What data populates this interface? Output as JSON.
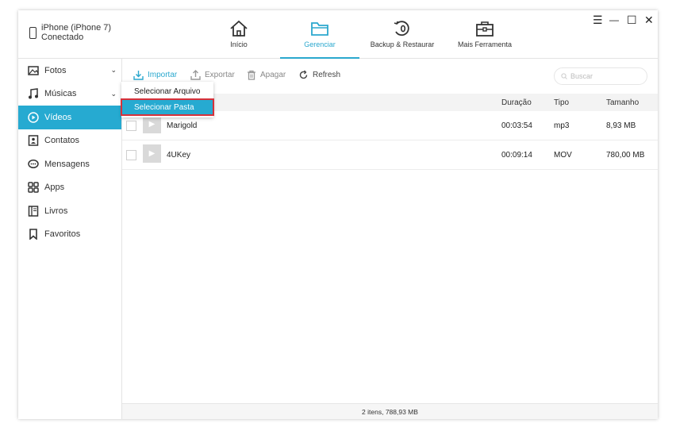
{
  "device": {
    "name": "iPhone (iPhone 7)",
    "status": "Conectado"
  },
  "nav": {
    "tabs": [
      {
        "label": "Início",
        "icon": "home-icon"
      },
      {
        "label": "Gerenciar",
        "icon": "folder-icon"
      },
      {
        "label": "Backup & Restaurar",
        "icon": "backup-restore-icon"
      },
      {
        "label": "Mais Ferramenta",
        "icon": "toolbox-icon"
      }
    ],
    "active": "Gerenciar"
  },
  "window_controls": {
    "menu": "☰",
    "minimize": "—",
    "maximize": "☐",
    "close": "✕"
  },
  "sidebar": {
    "items": [
      {
        "label": "Fotos",
        "icon": "photo-icon"
      },
      {
        "label": "Músicas",
        "icon": "music-icon"
      },
      {
        "label": "Vídeos",
        "icon": "video-icon"
      },
      {
        "label": "Contatos",
        "icon": "contact-icon"
      },
      {
        "label": "Mensagens",
        "icon": "message-icon"
      },
      {
        "label": "Apps",
        "icon": "apps-icon"
      },
      {
        "label": "Livros",
        "icon": "book-icon"
      },
      {
        "label": "Favoritos",
        "icon": "bookmark-icon"
      }
    ],
    "active": "Vídeos"
  },
  "toolbar": {
    "import": "Importar",
    "export": "Exportar",
    "delete": "Apagar",
    "refresh": "Refresh",
    "search_placeholder": "Buscar"
  },
  "dropdown": {
    "items": [
      "Selecionar Arquivo",
      "Selecionar Pasta"
    ],
    "highlighted": "Selecionar Pasta"
  },
  "table": {
    "columns": [
      "Duração",
      "Tipo",
      "Tamanho"
    ],
    "rows": [
      {
        "name": "Marigold",
        "duration": "00:03:54",
        "type": "mp3",
        "size": "8,93 MB"
      },
      {
        "name": "4UKey",
        "duration": "00:09:14",
        "type": "MOV",
        "size": "780,00 MB"
      }
    ]
  },
  "status": "2 itens, 788,93 MB",
  "colors": {
    "accent": "#26aad1",
    "highlight_border": "#d6313a"
  }
}
